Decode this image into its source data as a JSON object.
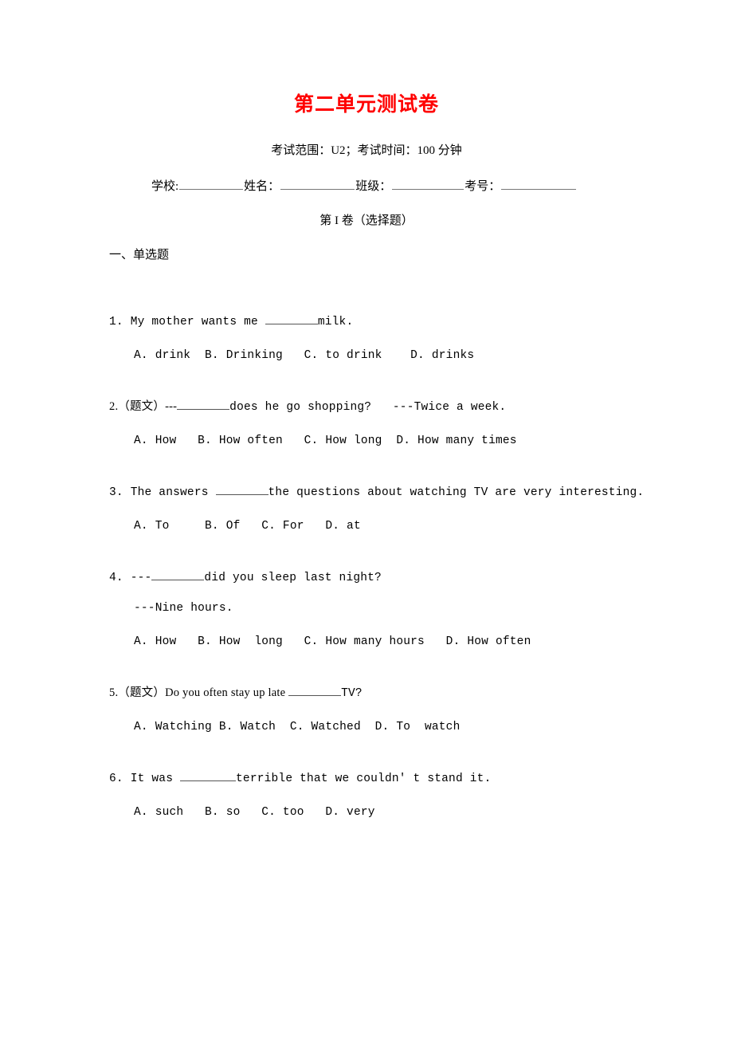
{
  "document": {
    "title": "第二单元测试卷",
    "title_color": "#ff0000",
    "exam_meta": "考试范围：U2；考试时间：100 分钟",
    "paper_part": "第 I 卷（选择题）",
    "section_heading": "一、单选题"
  },
  "student_info": {
    "school_label": "学校:",
    "name_label": "姓名：",
    "class_label": "班级：",
    "exam_number_label": "考号："
  },
  "questions": [
    {
      "number": "1.",
      "stem_before": "1. My mother wants me ",
      "stem_after": "milk.",
      "blank_width": "qb-66",
      "extra_line": "",
      "options": "A. drink  B. Drinking   C. to drink    D. drinks"
    },
    {
      "number": "2.",
      "stem_before": "2.（题文）---",
      "stem_after": "does he go shopping?   ---Twice a week.",
      "blank_width": "qb-66",
      "extra_line": "",
      "options": "A. How   B. How often   C. How long  D. How many times"
    },
    {
      "number": "3.",
      "stem_before": "3. The answers ",
      "stem_after": "the questions about watching TV are very interesting.",
      "blank_width": "qb-66",
      "extra_line": "",
      "options": "A. To     B. Of   C. For   D. at"
    },
    {
      "number": "4.",
      "stem_before": "4. ---",
      "stem_after": "did you sleep last night?",
      "blank_width": "qb-66",
      "extra_line": "---Nine hours.",
      "options": "A. How   B. How  long   C. How many hours   D. How often"
    },
    {
      "number": "5.",
      "stem_before": "5.（题文）Do you often stay up late ",
      "stem_after": "TV?",
      "blank_width": "qb-66",
      "extra_line": "",
      "options": "A. Watching B. Watch  C. Watched  D. To  watch"
    },
    {
      "number": "6.",
      "stem_before": "6. It was ",
      "stem_after": "terrible that we couldn' t stand it.",
      "blank_width": "qb-70",
      "extra_line": "",
      "options": "A. such   B. so   C. too   D. very"
    }
  ]
}
